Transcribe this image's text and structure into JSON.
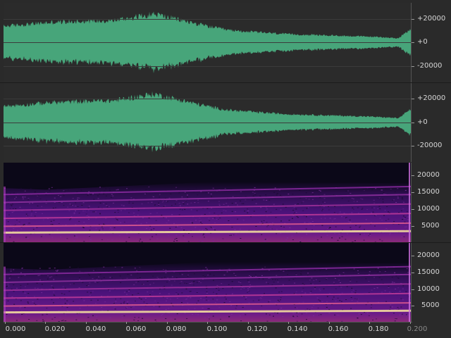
{
  "colors": {
    "background": "#2a2a2a",
    "waveform": "#47a57a",
    "spectrogram_bg": "#0b0818",
    "playhead": "#d070e0"
  },
  "waveform_axis": {
    "ticks": [
      "+20000",
      "+0",
      "-20000"
    ]
  },
  "spectrogram_axis": {
    "ticks": [
      "20000",
      "15000",
      "10000",
      "5000"
    ]
  },
  "time_axis": {
    "ticks": [
      "0.000",
      "0.020",
      "0.040",
      "0.060",
      "0.080",
      "0.100",
      "0.120",
      "0.140",
      "0.160",
      "0.180",
      "0.200"
    ]
  }
}
